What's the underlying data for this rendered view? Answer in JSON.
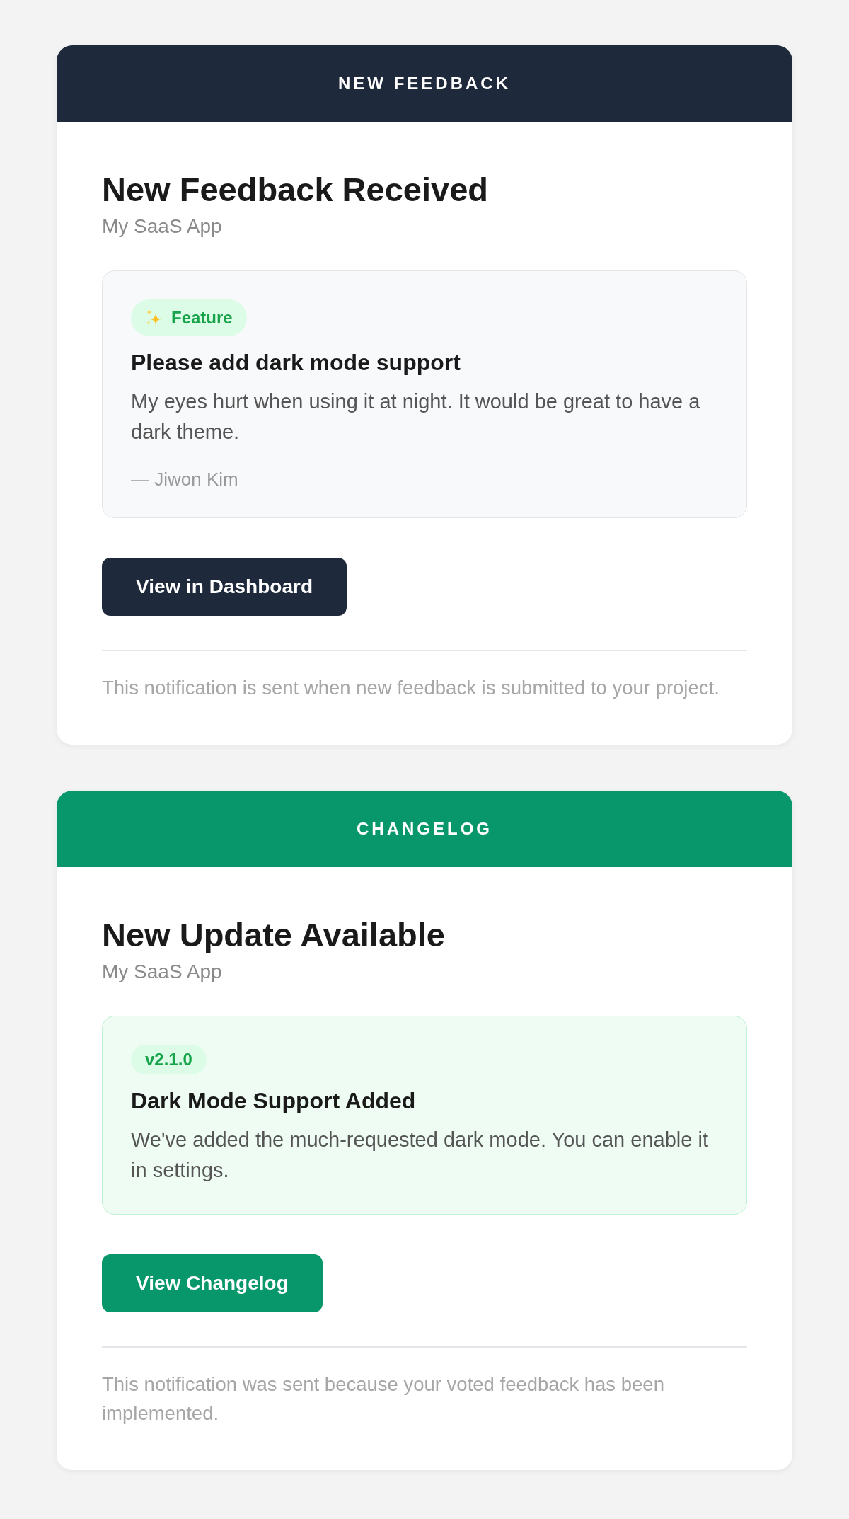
{
  "cards": [
    {
      "kind": "feedback",
      "header": "NEW FEEDBACK",
      "title": "New Feedback Received",
      "subtitle": "My SaaS App",
      "item": {
        "badge": "Feature",
        "title": "Please add dark mode support",
        "description": "My eyes hurt when using it at night. It would be great to have a dark theme.",
        "author": "— Jiwon Kim"
      },
      "button": "View in Dashboard",
      "footer": "This notification is sent when new feedback is submitted to your project."
    },
    {
      "kind": "changelog",
      "header": "CHANGELOG",
      "title": "New Update Available",
      "subtitle": "My SaaS App",
      "item": {
        "badge": "v2.1.0",
        "title": "Dark Mode Support Added",
        "description": "We've added the much-requested dark mode. You can enable it in settings."
      },
      "button": "View Changelog",
      "footer": "This notification was sent because your voted feedback has been implemented."
    }
  ]
}
